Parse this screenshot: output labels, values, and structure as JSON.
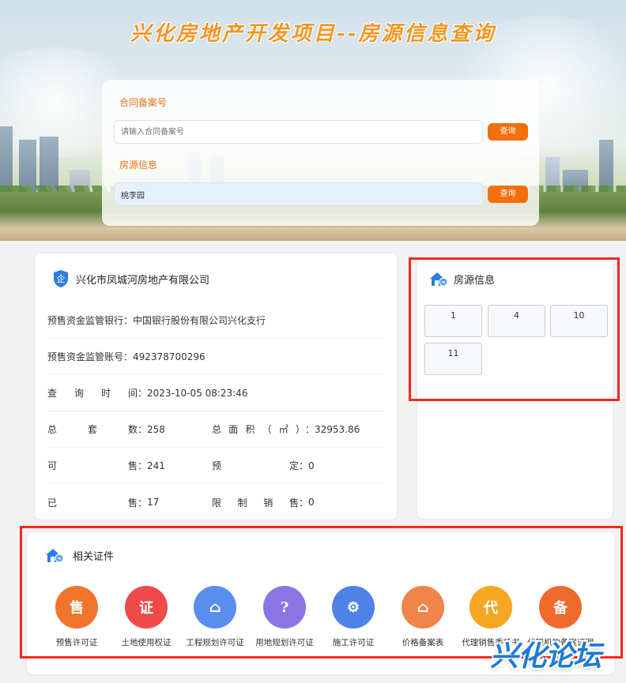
{
  "banner": {
    "title": "兴化房地产开发项目--房源信息查询"
  },
  "search": {
    "contract_label": "合同备案号",
    "contract_placeholder": "请输入合同备案号",
    "contract_value": "",
    "query_label": "查询",
    "housing_label": "房源信息",
    "housing_value": "桃李园",
    "query_label_2": "查询"
  },
  "company": {
    "name": "兴化市凤城河房地产有限公司",
    "bank_label": "预售资金监管银行：",
    "bank_value": "中国银行股份有限公司兴化支行",
    "account_label": "预售资金监管账号：",
    "account_value": "492378700296",
    "query_time_chars": [
      "查",
      "询",
      "时",
      "间"
    ],
    "query_time_value": "2023-10-05 08:23:46",
    "total_chars": [
      "总",
      "套",
      "数"
    ],
    "total_value": "258",
    "area_chars": [
      "总",
      "面",
      "积",
      "（",
      "㎡",
      "）"
    ],
    "area_value": "32953.86",
    "avail_chars": [
      "可",
      "售"
    ],
    "avail_value": "241",
    "reserved_chars": [
      "预",
      "定"
    ],
    "reserved_value": "0",
    "sold_chars": [
      "已",
      "售"
    ],
    "sold_value": "17",
    "restricted_chars": [
      "限",
      "制",
      "销",
      "售"
    ],
    "restricted_value": "0",
    "colon": "："
  },
  "housing": {
    "title": "房源信息",
    "units": [
      "1",
      "4",
      "10",
      "11"
    ]
  },
  "certs": {
    "title": "相关证件",
    "items": [
      {
        "label": "预售许可证",
        "glyph": "售",
        "color": "#f0742a"
      },
      {
        "label": "土地使用权证",
        "glyph": "证",
        "color": "#ee4a4a"
      },
      {
        "label": "工程规划许可证",
        "glyph": "⌂",
        "color": "#5b8def"
      },
      {
        "label": "用地规划许可证",
        "glyph": "?",
        "color": "#8a76e2"
      },
      {
        "label": "施工许可证",
        "glyph": "⚙",
        "color": "#4e82e6"
      },
      {
        "label": "价格备案表",
        "glyph": "⌂",
        "color": "#f0844a"
      },
      {
        "label": "代理销售委托书",
        "glyph": "代",
        "color": "#f5a623"
      },
      {
        "label": "代理机构备案证明",
        "glyph": "备",
        "color": "#f06a2a"
      }
    ]
  },
  "watermark": {
    "text": "兴化论坛"
  },
  "colors": {
    "accent": "#f26f0e",
    "highlight": "#f2281e",
    "brand_blue": "#1e7ad6"
  }
}
